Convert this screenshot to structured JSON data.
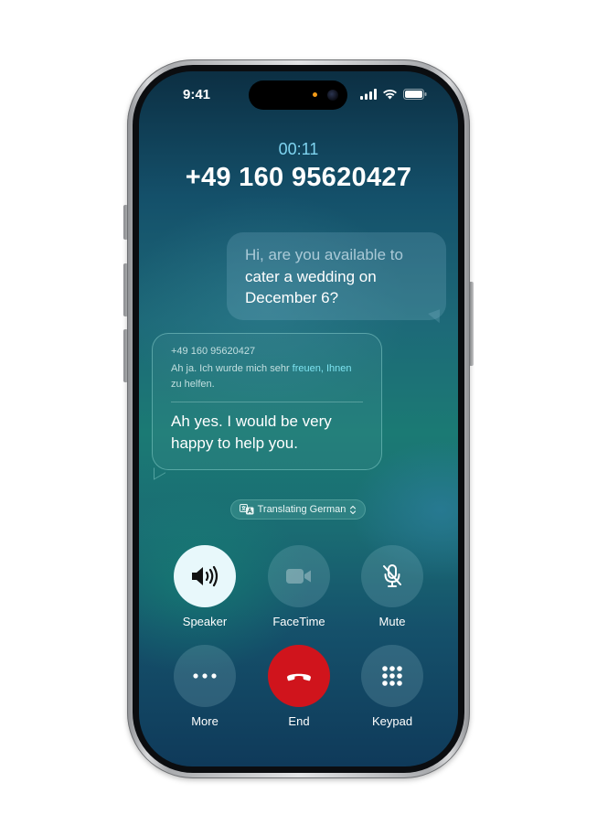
{
  "status_bar": {
    "time": "9:41",
    "icons": [
      "signal-icon",
      "wifi-icon",
      "battery-icon"
    ]
  },
  "call": {
    "timer": "00:11",
    "number": "+49 160 95620427"
  },
  "messages": {
    "sent": {
      "line_faded": "Hi, are you available to",
      "line_rest": "cater a wedding on December 6?"
    },
    "received": {
      "sender": "+49 160 95620427",
      "original_text_start": "Ah ja. Ich wurde mich sehr ",
      "original_text_highlight": "freuen, Ihnen",
      "original_text_end": " zu helfen.",
      "translation": "Ah yes. I would be very happy to help you."
    }
  },
  "translation_pill": {
    "label": "Translating German",
    "icon": "translate-icon",
    "chevron": "chevron-up-down-icon"
  },
  "controls": {
    "speaker": "Speaker",
    "facetime": "FaceTime",
    "mute": "Mute",
    "more": "More",
    "end": "End",
    "keypad": "Keypad"
  },
  "colors": {
    "end_button": "#d0141c",
    "timer": "#7fd4f0",
    "speaker_active": "#e8f8fb"
  }
}
